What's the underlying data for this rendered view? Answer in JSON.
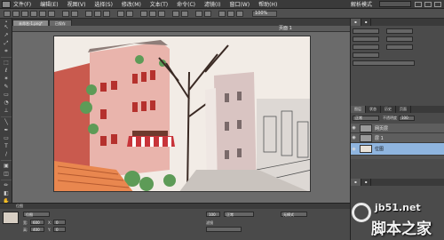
{
  "menubar": {
    "items": [
      "文件(F)",
      "编辑(E)",
      "视图(V)",
      "选择(S)",
      "修改(M)",
      "文本(T)",
      "命令(C)",
      "滤镜(I)",
      "窗口(W)",
      "帮助(H)"
    ],
    "workspace_mode": "解析模式"
  },
  "toolbar": {
    "zoom": "100%"
  },
  "document": {
    "tabs": [
      "未命名-1.png*",
      "已保存"
    ],
    "status": "页面 1"
  },
  "layers_panel": {
    "tabs": [
      "图层",
      "状态",
      "历史",
      "页面"
    ],
    "mode": "正常",
    "opacity_label": "不透明度",
    "opacity": "100",
    "layers": [
      {
        "name": "网页层",
        "type": "group"
      },
      {
        "name": "层 1",
        "type": "group"
      },
      {
        "name": "位图",
        "type": "bitmap",
        "selected": true
      }
    ]
  },
  "properties": {
    "header": "位图",
    "name": "位图",
    "width_label": "宽:",
    "width": "600",
    "height_label": "高:",
    "height": "400",
    "x_label": "X:",
    "x": "0",
    "y_label": "Y:",
    "y": "0",
    "opacity": "100",
    "blend": "正常",
    "filter_label": "滤镜",
    "effect": "无模式"
  },
  "watermark": {
    "url": "jb51.net",
    "name": "脚本之家"
  },
  "colors": {
    "ui_dark": "#3a3a3a",
    "panel": "#4b4b4b",
    "selection": "#8fb5df",
    "awning_red": "#c8343a"
  }
}
